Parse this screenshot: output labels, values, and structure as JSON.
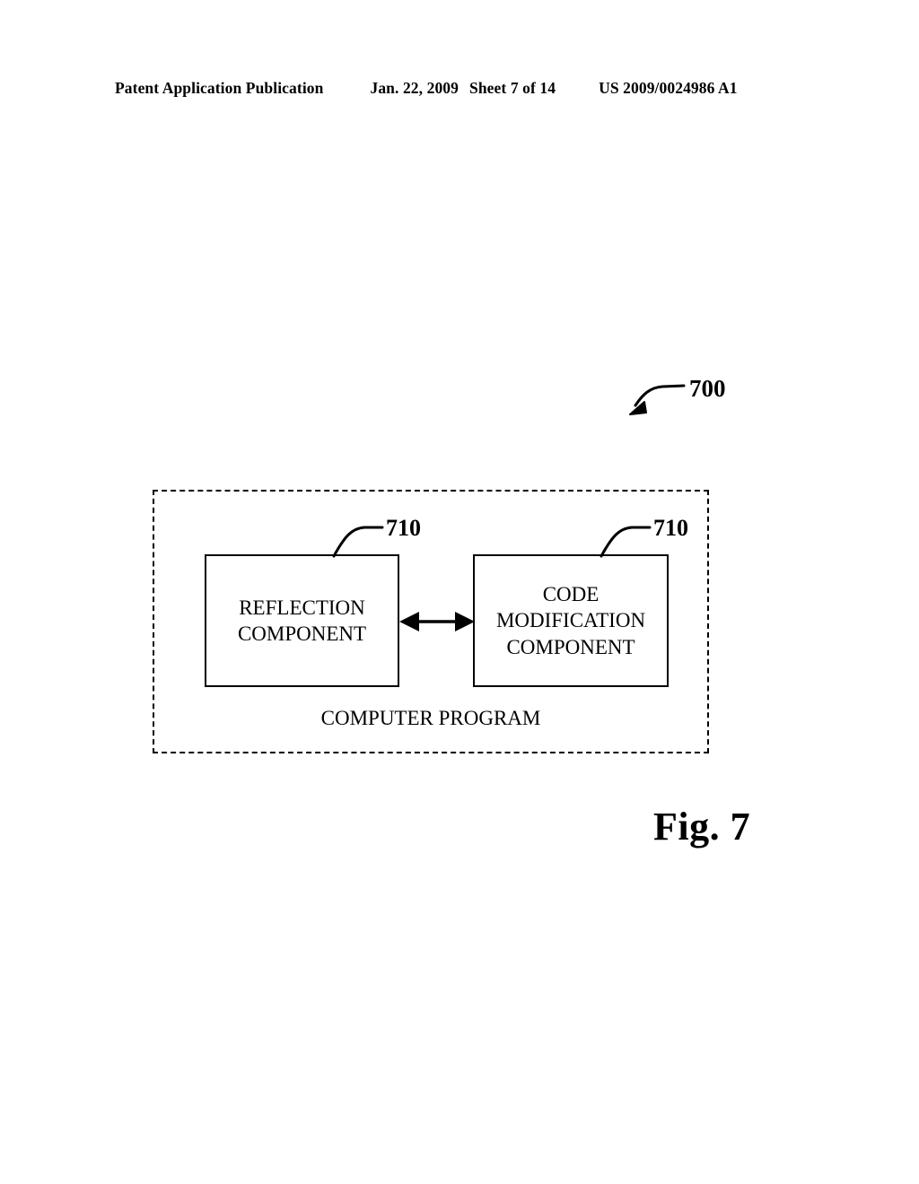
{
  "header": {
    "publication": "Patent Application Publication",
    "date": "Jan. 22, 2009",
    "sheet": "Sheet 7 of 14",
    "document_number": "US 2009/0024986 A1"
  },
  "figure": {
    "caption": "Fig. 7",
    "system_reference": "700",
    "container_label": "COMPUTER PROGRAM",
    "components": [
      {
        "reference": "710",
        "label": "REFLECTION\nCOMPONENT"
      },
      {
        "reference": "710",
        "label": "CODE\nMODIFICATION\nCOMPONENT"
      }
    ],
    "connector": {
      "type": "double-headed-arrow",
      "from": "REFLECTION COMPONENT",
      "to": "CODE MODIFICATION COMPONENT"
    }
  },
  "colors": {
    "ink": "#000000",
    "paper": "#ffffff"
  }
}
